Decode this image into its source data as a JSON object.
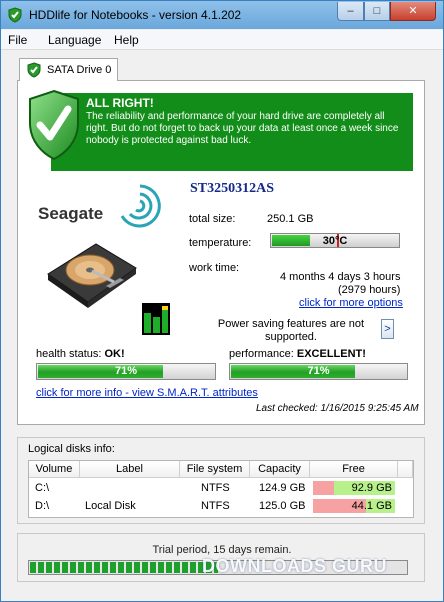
{
  "window": {
    "title": "HDDlife for Notebooks - version 4.1.202",
    "min": "–",
    "max": "□",
    "close": "✕"
  },
  "menu": [
    "File",
    "Language",
    "Help"
  ],
  "tab": {
    "label": "SATA Drive 0"
  },
  "banner": {
    "title": "ALL RIGHT!",
    "text": "The reliability and performance of your hard drive are completely all right. But do not forget to back up your data at least once a week since nobody is protected against bad luck."
  },
  "drive": {
    "model": "ST3250312AS",
    "brand": "Seagate",
    "total_size_label": "total size:",
    "total_size": "250.1 GB",
    "temperature_label": "temperature:",
    "temperature": "30°C",
    "temperature_fill": 0.3,
    "work_time_label": "work time:",
    "work_time": "4 months 4 days 3 hours",
    "work_time_hours": "(2979 hours)",
    "more_options_link": "click for more options",
    "power_saving": "Power saving features are not supported.",
    "arrow": ">"
  },
  "health": {
    "label": "health status:",
    "value": "OK!",
    "percent_text": "71%",
    "percent": 71
  },
  "performance": {
    "label": "performance:",
    "value": "EXCELLENT!",
    "percent_text": "71%",
    "percent": 71
  },
  "smart_link": "click for more info - view S.M.A.R.T. attributes",
  "last_checked": "Last checked:  1/16/2015  9:25:45 AM",
  "logical": {
    "title": "Logical disks info:",
    "columns": [
      "Volume",
      "Label",
      "File system",
      "Capacity",
      "Free"
    ],
    "rows": [
      {
        "volume": "C:\\",
        "label": "",
        "fs": "NTFS",
        "capacity": "124.9 GB",
        "free": "92.9 GB",
        "free_ratio": 0.744
      },
      {
        "volume": "D:\\",
        "label": "Local Disk",
        "fs": "NTFS",
        "capacity": "125.0 GB",
        "free": "44.1 GB",
        "free_ratio": 0.353
      }
    ]
  },
  "trial": {
    "text": "Trial period, 15 days remain.",
    "fill": 0.5
  },
  "watermark": "DOWNLOADS GURU",
  "colors": {
    "banner": "#138d19",
    "accent_link": "#0026c6",
    "model": "#13298a",
    "free_bg": "#f7a2a2",
    "free_fill": "#b8f08c"
  }
}
